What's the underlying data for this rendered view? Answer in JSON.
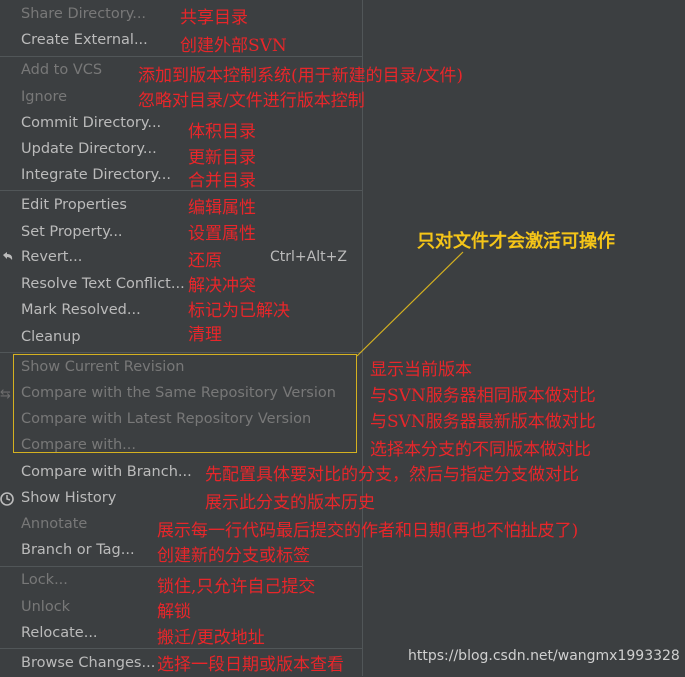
{
  "menu": {
    "share_directory": "Share Directory...",
    "create_external": "Create External...",
    "add_to_vcs": "Add to VCS",
    "ignore": "Ignore",
    "commit_directory": "Commit Directory...",
    "update_directory": "Update Directory...",
    "integrate_directory": "Integrate Directory...",
    "edit_properties": "Edit Properties",
    "set_property": "Set Property...",
    "revert": "Revert...",
    "revert_shortcut": "Ctrl+Alt+Z",
    "resolve_text_conflict": "Resolve Text Conflict...",
    "mark_resolved": "Mark Resolved...",
    "cleanup": "Cleanup",
    "show_current_revision": "Show Current Revision",
    "compare_same_repo": "Compare with the Same Repository Version",
    "compare_latest_repo": "Compare with Latest Repository Version",
    "compare_with": "Compare with...",
    "compare_with_branch": "Compare with Branch...",
    "show_history": "Show History",
    "annotate": "Annotate",
    "branch_or_tag": "Branch or Tag...",
    "lock": "Lock...",
    "unlock": "Unlock",
    "relocate": "Relocate...",
    "browse_changes": "Browse Changes..."
  },
  "notes": {
    "share_directory": "共享目录",
    "create_external": "创建外部SVN",
    "add_to_vcs": "添加到版本控制系统(用于新建的目录/文件)",
    "ignore": "忽略对目录/文件进行版本控制",
    "commit_directory": "体积目录",
    "update_directory": "更新目录",
    "integrate_directory": "合并目录",
    "edit_properties": "编辑属性",
    "set_property": "设置属性",
    "revert": "还原",
    "resolve_text_conflict": "解决冲突",
    "mark_resolved": "标记为已解决",
    "cleanup": "清理",
    "show_current_revision": "显示当前版本",
    "compare_same_repo": "与SVN服务器相同版本做对比",
    "compare_latest_repo": "与SVN服务器最新版本做对比",
    "compare_with": "选择本分支的不同版本做对比",
    "compare_with_branch": "先配置具体要对比的分支，然后与指定分支做对比",
    "show_history": "展示此分支的版本历史",
    "annotate": "展示每一行代码最后提交的作者和日期(再也不怕扯皮了)",
    "branch_or_tag": "创建新的分支或标签",
    "lock": "锁住,只允许自己提交",
    "unlock": "解锁",
    "relocate": "搬迁/更改地址",
    "browse_changes": "选择一段日期或版本查看"
  },
  "callout": "只对文件才会激活可操作",
  "watermark": "https://blog.csdn.net/wangmx1993328",
  "colors": {
    "background": "#3c3f41",
    "menu_text": "#bbbbbb",
    "disabled_text": "#787878",
    "annotation_red": "#e8262a",
    "callout_yellow": "#f5c518"
  }
}
